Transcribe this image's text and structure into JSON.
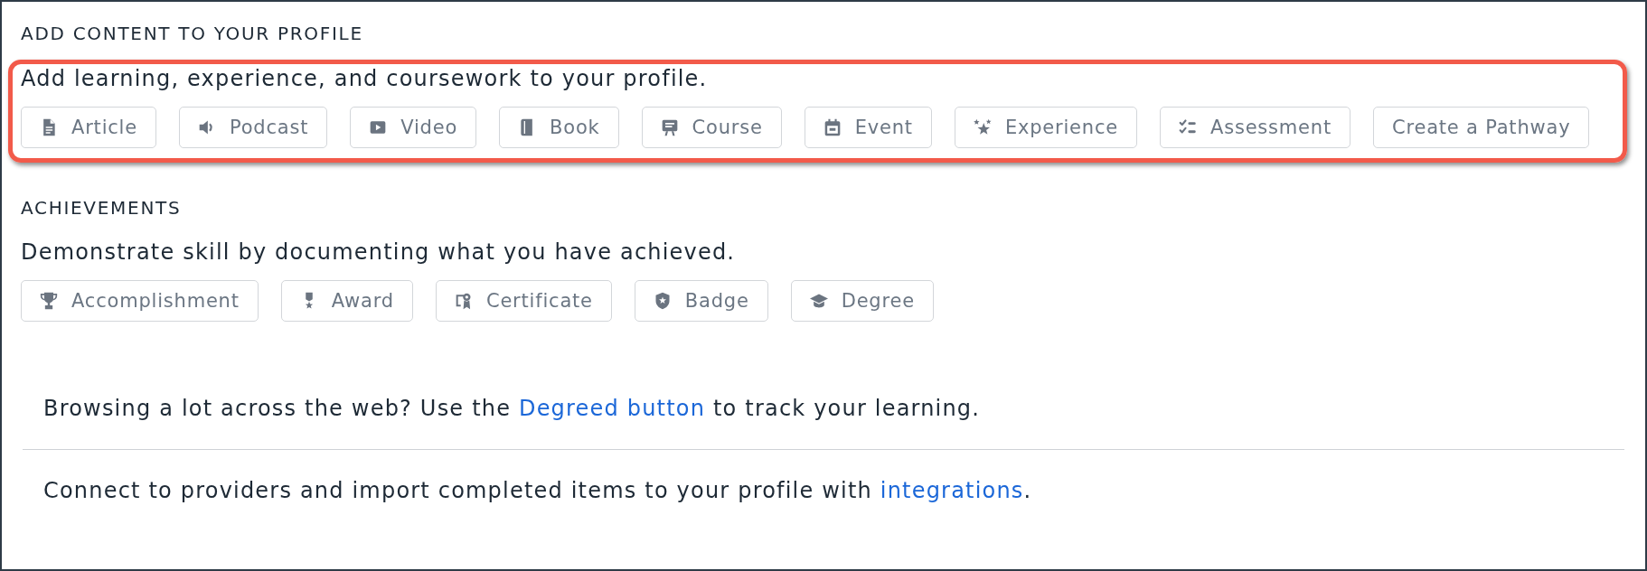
{
  "add_content": {
    "heading": "ADD CONTENT TO YOUR PROFILE",
    "highlighted": true,
    "description": "Add learning, experience, and coursework to your profile.",
    "buttons": [
      {
        "kind": "article",
        "label": "Article"
      },
      {
        "kind": "podcast",
        "label": "Podcast"
      },
      {
        "kind": "video",
        "label": "Video"
      },
      {
        "kind": "book",
        "label": "Book"
      },
      {
        "kind": "course",
        "label": "Course"
      },
      {
        "kind": "event",
        "label": "Event"
      },
      {
        "kind": "experience",
        "label": "Experience"
      },
      {
        "kind": "assessment",
        "label": "Assessment"
      },
      {
        "kind": "pathway",
        "label": "Create a Pathway"
      }
    ]
  },
  "achievements": {
    "heading": "ACHIEVEMENTS",
    "highlighted": false,
    "description": "Demonstrate skill by documenting what you have achieved.",
    "buttons": [
      {
        "kind": "accomplishment",
        "label": "Accomplishment"
      },
      {
        "kind": "award",
        "label": "Award"
      },
      {
        "kind": "certificate",
        "label": "Certificate"
      },
      {
        "kind": "badge",
        "label": "Badge"
      },
      {
        "kind": "degree",
        "label": "Degree"
      }
    ]
  },
  "tips": [
    {
      "text_before": "Browsing a lot across the web? Use the ",
      "link": "Degreed button",
      "text_after": " to track your learning."
    },
    {
      "text_before": "Connect to providers and import completed items to your profile with ",
      "link": "integrations",
      "text_after": "."
    }
  ]
}
